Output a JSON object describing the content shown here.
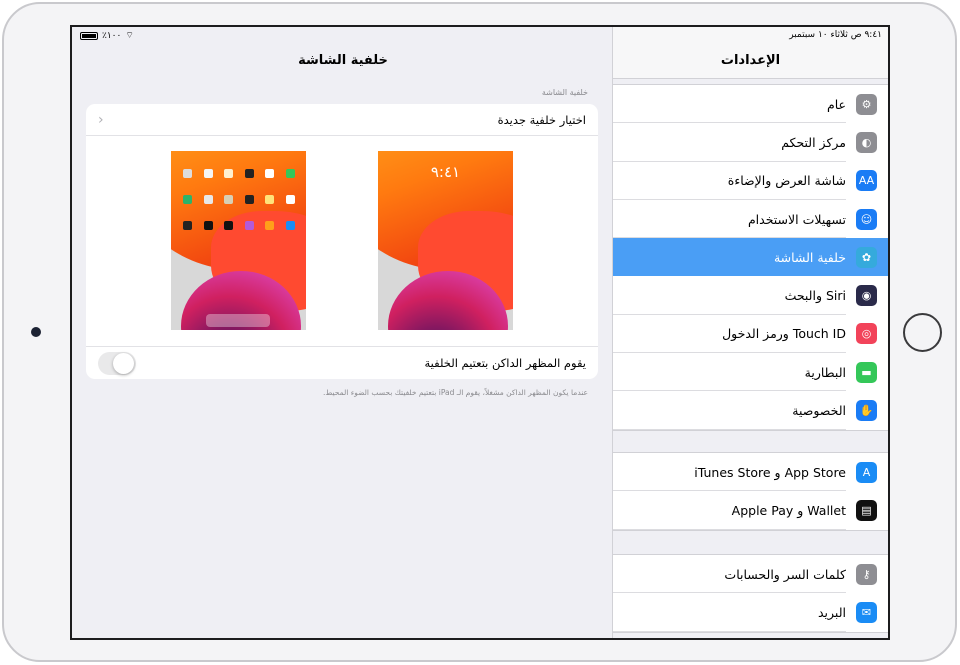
{
  "status_bar": {
    "time": "٩:٤١ ص",
    "date": "ثلاثاء ١٠ سبتمبر",
    "battery": "٪١٠٠"
  },
  "sidebar": {
    "title": "الإعدادات",
    "groups": [
      [
        {
          "label": "عام",
          "icon": "gear-icon",
          "color": "#8e8e93",
          "glyph": "⚙"
        },
        {
          "label": "مركز التحكم",
          "icon": "control-center-icon",
          "color": "#8e8e93",
          "glyph": "◐"
        },
        {
          "label": "شاشة العرض والإضاءة",
          "icon": "display-brightness-icon",
          "color": "#1a7cf5",
          "glyph": "AA"
        },
        {
          "label": "تسهيلات الاستخدام",
          "icon": "accessibility-icon",
          "color": "#1a7cf5",
          "glyph": "☺"
        },
        {
          "label": "خلفية الشاشة",
          "icon": "wallpaper-icon",
          "color": "#35aadc",
          "glyph": "✿",
          "selected": true
        },
        {
          "label": "Siri والبحث",
          "icon": "siri-icon",
          "color": "#2a2a4a",
          "glyph": "◉"
        },
        {
          "label": "Touch ID ورمز الدخول",
          "icon": "fingerprint-icon",
          "color": "#f2435a",
          "glyph": "◎"
        },
        {
          "label": "البطارية",
          "icon": "battery-icon",
          "color": "#34c759",
          "glyph": "▬"
        },
        {
          "label": "الخصوصية",
          "icon": "hand-icon",
          "color": "#1a7cf5",
          "glyph": "✋"
        }
      ],
      [
        {
          "label": "App Store و iTunes Store",
          "icon": "app-store-icon",
          "color": "#1a8cf5",
          "glyph": "A"
        },
        {
          "label": "Wallet و Apple Pay",
          "icon": "wallet-icon",
          "color": "#111111",
          "glyph": "▤"
        }
      ],
      [
        {
          "label": "كلمات السر والحسابات",
          "icon": "key-icon",
          "color": "#8e8e93",
          "glyph": "⚷"
        },
        {
          "label": "البريد",
          "icon": "mail-icon",
          "color": "#1a8cf5",
          "glyph": "✉"
        }
      ]
    ]
  },
  "main": {
    "title": "خلفية الشاشة",
    "section_label": "خلفية الشاشة",
    "choose_label": "اختيار خلفية جديدة",
    "lock_time": "٩:٤١",
    "dark_dims_label": "يقوم المظهر الداكن بتعتيم الخلفية",
    "dark_dims_on": false,
    "footer": "عندما يكون المظهر الداكن مشغلاً، يقوم الـ iPad بتعتيم خلفيتك بحسب الضوء المحيط."
  }
}
